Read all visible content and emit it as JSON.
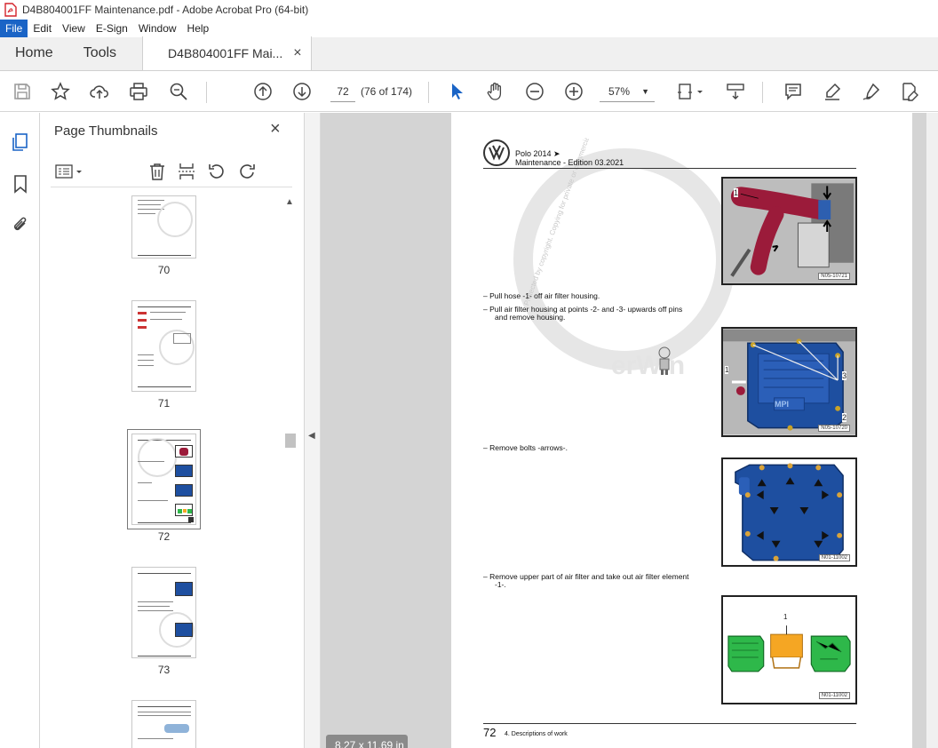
{
  "window": {
    "title": "D4B804001FF Maintenance.pdf - Adobe Acrobat Pro (64-bit)"
  },
  "menu": [
    "File",
    "Edit",
    "View",
    "E-Sign",
    "Window",
    "Help"
  ],
  "tabs": {
    "home": "Home",
    "tools": "Tools",
    "doc": "D4B804001FF Mai...",
    "doc_close": "×"
  },
  "toolbar": {
    "page_value": "72",
    "page_count": "(76 of 174)",
    "zoom": "57%"
  },
  "thumbnails": {
    "title": "Page Thumbnails",
    "close": "×",
    "pages": [
      {
        "label": "70"
      },
      {
        "label": "71"
      },
      {
        "label": "72"
      },
      {
        "label": "73"
      }
    ]
  },
  "document": {
    "header_line1": "Polo 2014 ➤",
    "header_line2": "Maintenance - Edition 03.2021",
    "step1": "–    Pull hose -1- off air filter housing.",
    "step2a": "–    Pull air filter housing at points -2- and -3- upwards off pins",
    "step2b": "and remove housing.",
    "step3": "–    Remove bolts -arrows-.",
    "step4a": "–    Remove upper part of air filter and take out air filter element",
    "step4b": "-1-.",
    "fig1_code": "N05-10721",
    "fig2_code": "N05-10720",
    "fig3_code": "N01-11002",
    "fig4_code": "N01-11002",
    "fig1_label": "1",
    "fig2_label1": "1",
    "fig2_label2": "2",
    "fig2_label3": "3",
    "fig2_mpi": "MPI",
    "fig4_label": "1",
    "footer_num": "72",
    "footer_text": "4. Descriptions of work",
    "watermark": "Protected by copyright. Copying for private or commercial purposes, in part or in whole, is not permitted unless authorised by Volkswagen AG. Volkswagen AG does not guarantee or accept any liability",
    "watermark_brand": "erWin"
  },
  "status": {
    "page_size": "8.27 x 11.69 in"
  },
  "colors": {
    "accent": "#1a64c6",
    "hose": "#9b1b3a",
    "housing": "#1e4fa0",
    "filter_green": "#2eb84a",
    "filter_element": "#f5a623"
  }
}
